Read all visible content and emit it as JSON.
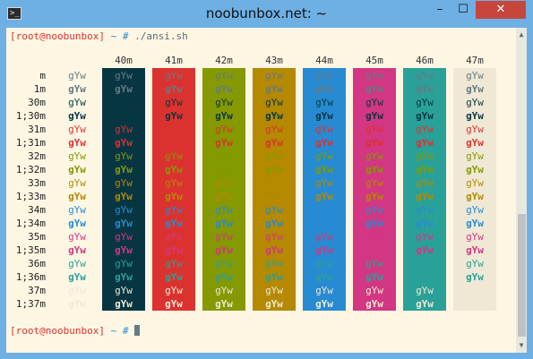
{
  "window": {
    "title": "noobunbox.net: ~",
    "icon_label": ">_",
    "min_label": "–",
    "max_label": "☐",
    "close_label": "✕"
  },
  "terminal": {
    "prompt_user": "[root@noobunbox]",
    "prompt_rest": " ~ # ",
    "command": "./ansi.sh",
    "sample_text": "gYw",
    "bg_headers": [
      "40m",
      "41m",
      "42m",
      "43m",
      "44m",
      "45m",
      "46m",
      "47m"
    ],
    "row_labels": [
      "m",
      "1m",
      "30m",
      "1;30m",
      "31m",
      "1;31m",
      "32m",
      "1;32m",
      "33m",
      "1;33m",
      "34m",
      "1;34m",
      "35m",
      "1;35m",
      "36m",
      "1;36m",
      "37m",
      "1;37m"
    ]
  },
  "colors": {
    "bg": [
      "#073642",
      "#dc322f",
      "#859900",
      "#b58900",
      "#268bd2",
      "#d33682",
      "#2aa198",
      "#eee8d5"
    ],
    "fg": [
      "#073642",
      "#dc322f",
      "#859900",
      "#b58900",
      "#268bd2",
      "#d33682",
      "#2aa198",
      "#eee8d5"
    ],
    "default_fg": "#657b83",
    "default_bg": "#fdf6e3"
  }
}
